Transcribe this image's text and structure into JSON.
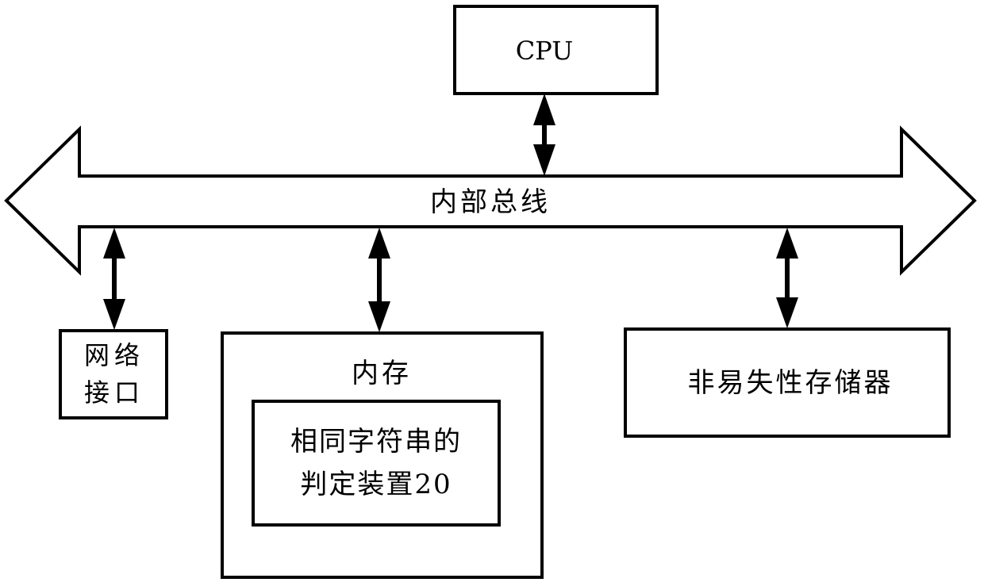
{
  "diagram": {
    "type": "hardware-block-diagram",
    "colors": {
      "stroke": "#000000",
      "fill": "#ffffff"
    },
    "bus": {
      "label": "内部总线",
      "shape": "double-headed-block-arrow"
    },
    "nodes": {
      "cpu": {
        "label": "CPU"
      },
      "network_interface": {
        "line1": "网络",
        "line2": "接口"
      },
      "memory": {
        "label": "内存",
        "child": {
          "line1": "相同字符串的",
          "line2": "判定装置20"
        }
      },
      "nonvolatile_storage": {
        "label": "非易失性存储器"
      }
    },
    "connections": [
      {
        "from": "cpu",
        "to": "bus",
        "direction": "bidirectional"
      },
      {
        "from": "network_interface",
        "to": "bus",
        "direction": "bidirectional"
      },
      {
        "from": "memory",
        "to": "bus",
        "direction": "bidirectional"
      },
      {
        "from": "nonvolatile_storage",
        "to": "bus",
        "direction": "bidirectional"
      }
    ]
  }
}
